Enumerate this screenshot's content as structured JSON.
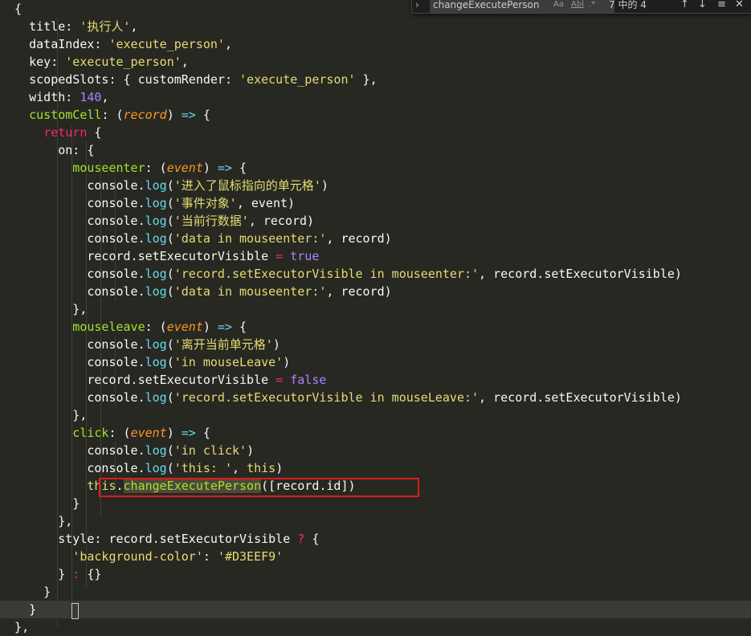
{
  "editor": {
    "lines": [
      [
        {
          "t": "  {",
          "c": "p"
        }
      ],
      [
        {
          "t": "    title: ",
          "c": "p"
        },
        {
          "t": "'执行人'",
          "c": "s"
        },
        {
          "t": ",",
          "c": "p"
        }
      ],
      [
        {
          "t": "    dataIndex: ",
          "c": "p"
        },
        {
          "t": "'execute_person'",
          "c": "s"
        },
        {
          "t": ",",
          "c": "p"
        }
      ],
      [
        {
          "t": "    key: ",
          "c": "p"
        },
        {
          "t": "'execute_person'",
          "c": "s"
        },
        {
          "t": ",",
          "c": "p"
        }
      ],
      [
        {
          "t": "    scopedSlots: { customRender: ",
          "c": "p"
        },
        {
          "t": "'execute_person'",
          "c": "s"
        },
        {
          "t": " },",
          "c": "p"
        }
      ],
      [
        {
          "t": "    width: ",
          "c": "p"
        },
        {
          "t": "140",
          "c": "n"
        },
        {
          "t": ",",
          "c": "p"
        }
      ],
      [
        {
          "t": "    customCell",
          "c": "f"
        },
        {
          "t": ": (",
          "c": "p"
        },
        {
          "t": "record",
          "c": "a"
        },
        {
          "t": ") ",
          "c": "p"
        },
        {
          "t": "=>",
          "c": "c"
        },
        {
          "t": " {",
          "c": "p"
        }
      ],
      [
        {
          "t": "      ",
          "c": "p"
        },
        {
          "t": "return",
          "c": "k"
        },
        {
          "t": " {",
          "c": "p"
        }
      ],
      [
        {
          "t": "        on: {",
          "c": "p"
        }
      ],
      [
        {
          "t": "          mouseenter",
          "c": "f"
        },
        {
          "t": ": (",
          "c": "p"
        },
        {
          "t": "event",
          "c": "a"
        },
        {
          "t": ") ",
          "c": "p"
        },
        {
          "t": "=>",
          "c": "c"
        },
        {
          "t": " {",
          "c": "p"
        }
      ],
      [
        {
          "t": "            console.",
          "c": "p"
        },
        {
          "t": "log",
          "c": "c"
        },
        {
          "t": "(",
          "c": "p"
        },
        {
          "t": "'进入了鼠标指向的单元格'",
          "c": "s"
        },
        {
          "t": ")",
          "c": "p"
        }
      ],
      [
        {
          "t": "            console.",
          "c": "p"
        },
        {
          "t": "log",
          "c": "c"
        },
        {
          "t": "(",
          "c": "p"
        },
        {
          "t": "'事件对象'",
          "c": "s"
        },
        {
          "t": ", event)",
          "c": "p"
        }
      ],
      [
        {
          "t": "            console.",
          "c": "p"
        },
        {
          "t": "log",
          "c": "c"
        },
        {
          "t": "(",
          "c": "p"
        },
        {
          "t": "'当前行数据'",
          "c": "s"
        },
        {
          "t": ", record)",
          "c": "p"
        }
      ],
      [
        {
          "t": "            console.",
          "c": "p"
        },
        {
          "t": "log",
          "c": "c"
        },
        {
          "t": "(",
          "c": "p"
        },
        {
          "t": "'data in mouseenter:'",
          "c": "s"
        },
        {
          "t": ", record)",
          "c": "p"
        }
      ],
      [
        {
          "t": "            record.setExecutorVisible ",
          "c": "p"
        },
        {
          "t": "=",
          "c": "k"
        },
        {
          "t": " ",
          "c": "p"
        },
        {
          "t": "true",
          "c": "n"
        }
      ],
      [
        {
          "t": "            console.",
          "c": "p"
        },
        {
          "t": "log",
          "c": "c"
        },
        {
          "t": "(",
          "c": "p"
        },
        {
          "t": "'record.setExecutorVisible in mouseenter:'",
          "c": "s"
        },
        {
          "t": ", record.setExecutorVisible)",
          "c": "p"
        }
      ],
      [
        {
          "t": "            console.",
          "c": "p"
        },
        {
          "t": "log",
          "c": "c"
        },
        {
          "t": "(",
          "c": "p"
        },
        {
          "t": "'data in mouseenter:'",
          "c": "s"
        },
        {
          "t": ", record)",
          "c": "p"
        }
      ],
      [
        {
          "t": "          },",
          "c": "p"
        }
      ],
      [
        {
          "t": "          mouseleave",
          "c": "f"
        },
        {
          "t": ": (",
          "c": "p"
        },
        {
          "t": "event",
          "c": "a"
        },
        {
          "t": ") ",
          "c": "p"
        },
        {
          "t": "=>",
          "c": "c"
        },
        {
          "t": " {",
          "c": "p"
        }
      ],
      [
        {
          "t": "            console.",
          "c": "p"
        },
        {
          "t": "log",
          "c": "c"
        },
        {
          "t": "(",
          "c": "p"
        },
        {
          "t": "'离开当前单元格'",
          "c": "s"
        },
        {
          "t": ")",
          "c": "p"
        }
      ],
      [
        {
          "t": "            console.",
          "c": "p"
        },
        {
          "t": "log",
          "c": "c"
        },
        {
          "t": "(",
          "c": "p"
        },
        {
          "t": "'in mouseLeave'",
          "c": "s"
        },
        {
          "t": ")",
          "c": "p"
        }
      ],
      [
        {
          "t": "            record.setExecutorVisible ",
          "c": "p"
        },
        {
          "t": "=",
          "c": "k"
        },
        {
          "t": " ",
          "c": "p"
        },
        {
          "t": "false",
          "c": "n"
        }
      ],
      [
        {
          "t": "            console.",
          "c": "p"
        },
        {
          "t": "log",
          "c": "c"
        },
        {
          "t": "(",
          "c": "p"
        },
        {
          "t": "'record.setExecutorVisible in mouseLeave:'",
          "c": "s"
        },
        {
          "t": ", record.setExecutorVisible)",
          "c": "p"
        }
      ],
      [
        {
          "t": "          },",
          "c": "p"
        }
      ],
      [
        {
          "t": "          click",
          "c": "f"
        },
        {
          "t": ": (",
          "c": "p"
        },
        {
          "t": "event",
          "c": "a"
        },
        {
          "t": ") ",
          "c": "p"
        },
        {
          "t": "=>",
          "c": "c"
        },
        {
          "t": " {",
          "c": "p"
        }
      ],
      [
        {
          "t": "            console.",
          "c": "p"
        },
        {
          "t": "log",
          "c": "c"
        },
        {
          "t": "(",
          "c": "p"
        },
        {
          "t": "'in click'",
          "c": "s"
        },
        {
          "t": ")",
          "c": "p"
        }
      ],
      [
        {
          "t": "            console.",
          "c": "p"
        },
        {
          "t": "log",
          "c": "c"
        },
        {
          "t": "(",
          "c": "p"
        },
        {
          "t": "'this: '",
          "c": "s"
        },
        {
          "t": ", ",
          "c": "p"
        },
        {
          "t": "this",
          "c": "s"
        },
        {
          "t": ")",
          "c": "p"
        }
      ],
      [
        {
          "t": "            ",
          "c": "p"
        },
        {
          "t": "this",
          "c": "s"
        },
        {
          "t": ".",
          "c": "p"
        },
        {
          "t": "changeExecutePerson",
          "c": "m"
        },
        {
          "t": "([record.id])",
          "c": "p"
        }
      ],
      [
        {
          "t": "          }",
          "c": "p"
        }
      ],
      [
        {
          "t": "        },",
          "c": "p"
        }
      ],
      [
        {
          "t": "        style: record.setExecutorVisible ",
          "c": "p"
        },
        {
          "t": "?",
          "c": "k"
        },
        {
          "t": " {",
          "c": "p"
        }
      ],
      [
        {
          "t": "          ",
          "c": "p"
        },
        {
          "t": "'background-color'",
          "c": "s"
        },
        {
          "t": ": ",
          "c": "p"
        },
        {
          "t": "'#D3EEF9'",
          "c": "s"
        }
      ],
      [
        {
          "t": "        } ",
          "c": "p"
        },
        {
          "t": ":",
          "c": "k"
        },
        {
          "t": " {}",
          "c": "p"
        }
      ],
      [
        {
          "t": "      }",
          "c": "p"
        }
      ],
      [
        {
          "t": "    }",
          "c": "p"
        }
      ],
      [
        {
          "t": "  },",
          "c": "p"
        }
      ]
    ]
  },
  "find_widget": {
    "toggle_icon": "chevron-right-icon",
    "query": "changeExecutePerson",
    "opt_case": "Aa",
    "opt_word": "Abl",
    "opt_regex": ".*",
    "match_count": "7 中的 4",
    "prev_glyph": "↑",
    "next_glyph": "↓",
    "select_glyph": "≡",
    "close_glyph": "✕"
  },
  "colors": {
    "background": "#272822",
    "string": "#e6db74",
    "keyword": "#f92672",
    "number": "#ae81ff",
    "function": "#a6e22e",
    "param": "#fd971f",
    "builtin": "#66d9ef",
    "highlight_box": "#e01b1b"
  }
}
